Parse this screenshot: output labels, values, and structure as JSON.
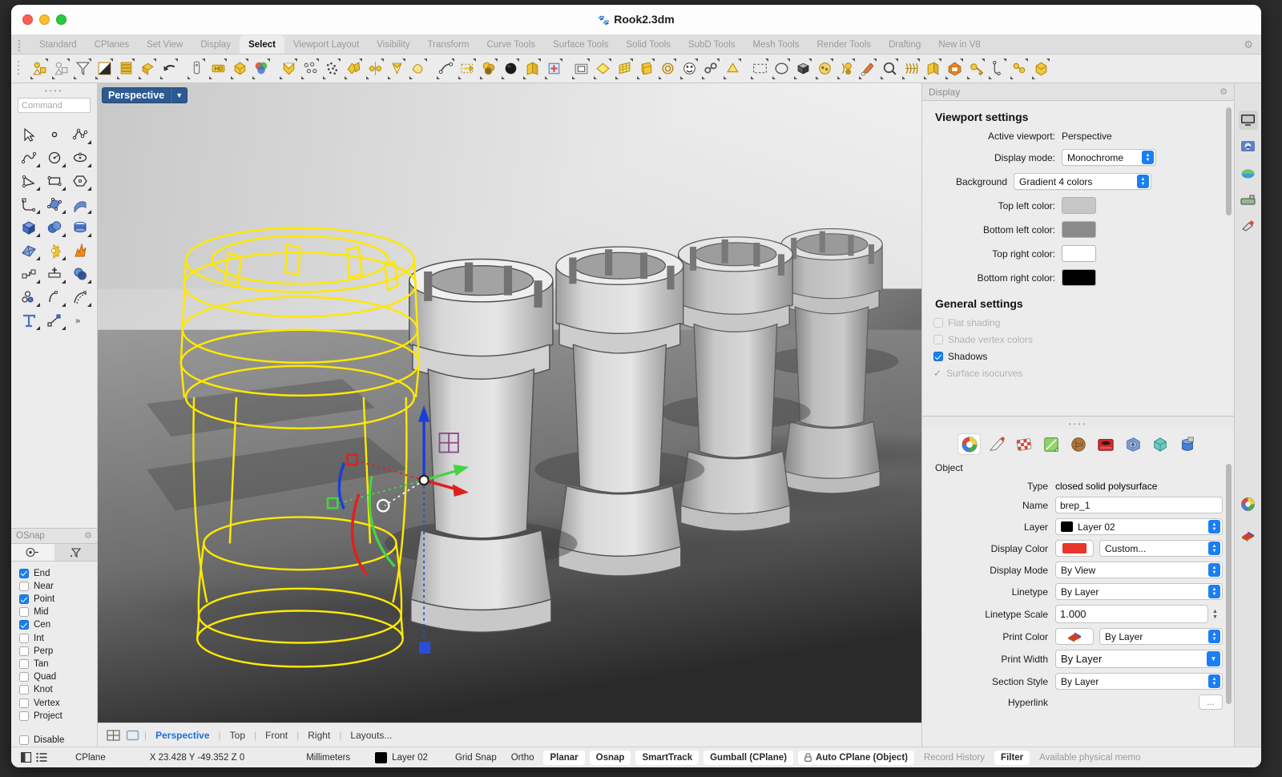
{
  "window": {
    "title": "Rook2.3dm"
  },
  "menu": {
    "tabs": [
      {
        "label": "Standard",
        "active": false
      },
      {
        "label": "CPlanes",
        "active": false
      },
      {
        "label": "Set View",
        "active": false
      },
      {
        "label": "Display",
        "active": false
      },
      {
        "label": "Select",
        "active": true
      },
      {
        "label": "Viewport Layout",
        "active": false
      },
      {
        "label": "Visibility",
        "active": false
      },
      {
        "label": "Transform",
        "active": false
      },
      {
        "label": "Curve Tools",
        "active": false
      },
      {
        "label": "Surface Tools",
        "active": false
      },
      {
        "label": "Solid Tools",
        "active": false
      },
      {
        "label": "SubD Tools",
        "active": false
      },
      {
        "label": "Mesh Tools",
        "active": false
      },
      {
        "label": "Render Tools",
        "active": false
      },
      {
        "label": "Drafting",
        "active": false
      },
      {
        "label": "New in V8",
        "active": false
      }
    ],
    "settings_icon": "gear-icon"
  },
  "command": {
    "placeholder": "Command"
  },
  "osnap": {
    "title": "OSnap",
    "items": [
      {
        "label": "End",
        "checked": true
      },
      {
        "label": "Near",
        "checked": false
      },
      {
        "label": "Point",
        "checked": true
      },
      {
        "label": "Mid",
        "checked": false
      },
      {
        "label": "Cen",
        "checked": true
      },
      {
        "label": "Int",
        "checked": false
      },
      {
        "label": "Perp",
        "checked": false
      },
      {
        "label": "Tan",
        "checked": false
      },
      {
        "label": "Quad",
        "checked": false
      },
      {
        "label": "Knot",
        "checked": false
      },
      {
        "label": "Vertex",
        "checked": false
      },
      {
        "label": "Project",
        "checked": false
      }
    ],
    "disable": {
      "label": "Disable",
      "checked": false
    }
  },
  "viewport": {
    "label": "Perspective",
    "tabs": [
      {
        "label": "Perspective",
        "active": true
      },
      {
        "label": "Top",
        "active": false
      },
      {
        "label": "Front",
        "active": false
      },
      {
        "label": "Right",
        "active": false
      },
      {
        "label": "Layouts...",
        "active": false
      }
    ]
  },
  "display_panel": {
    "header": "Display",
    "viewport_settings_title": "Viewport settings",
    "active_viewport_label": "Active viewport:",
    "active_viewport_value": "Perspective",
    "display_mode_label": "Display mode:",
    "display_mode_value": "Monochrome",
    "background_label": "Background",
    "background_value": "Gradient 4 colors",
    "top_left_label": "Top left color:",
    "top_left_color": "#c6c6c6",
    "bottom_left_label": "Bottom left color:",
    "bottom_left_color": "#8a8a8a",
    "top_right_label": "Top right color:",
    "top_right_color": "#ffffff",
    "bottom_right_label": "Bottom right color:",
    "bottom_right_color": "#000000",
    "general_settings_title": "General settings",
    "flat_shading": {
      "label": "Flat shading",
      "checked": false
    },
    "shade_vertex_colors": {
      "label": "Shade vertex colors",
      "checked": false
    },
    "shadows": {
      "label": "Shadows",
      "checked": true
    },
    "surface_isocurves": {
      "label": "Surface isocurves",
      "checked": true
    }
  },
  "object_panel": {
    "section": "Object",
    "type_label": "Type",
    "type_value": "closed solid polysurface",
    "name_label": "Name",
    "name_value": "brep_1",
    "layer_label": "Layer",
    "layer_value": "Layer 02",
    "layer_color": "#000000",
    "display_color_label": "Display Color",
    "display_color_swatch": "#e8342a",
    "display_color_value": "Custom...",
    "display_mode_label": "Display Mode",
    "display_mode_value": "By View",
    "linetype_label": "Linetype",
    "linetype_value": "By Layer",
    "linetype_scale_label": "Linetype Scale",
    "linetype_scale_value": "1.000",
    "print_color_label": "Print Color",
    "print_color_value": "By Layer",
    "print_width_label": "Print Width",
    "print_width_value": "By Layer",
    "section_style_label": "Section Style",
    "section_style_value": "By Layer",
    "hyperlink_label": "Hyperlink",
    "hyperlink_button": "..."
  },
  "statusbar": {
    "cplane": "CPlane",
    "coords": "X 23.428 Y -49.352 Z 0",
    "units": "Millimeters",
    "layer": "Layer 02",
    "layer_color": "#000000",
    "grid_snap": "Grid Snap",
    "ortho": "Ortho",
    "planar": "Planar",
    "osnap": "Osnap",
    "smarttrack": "SmartTrack",
    "gumball": "Gumball (CPlane)",
    "auto_cplane": "Auto CPlane (Object)",
    "record_history": "Record History",
    "filter": "Filter",
    "memory": "Available physical memo"
  }
}
